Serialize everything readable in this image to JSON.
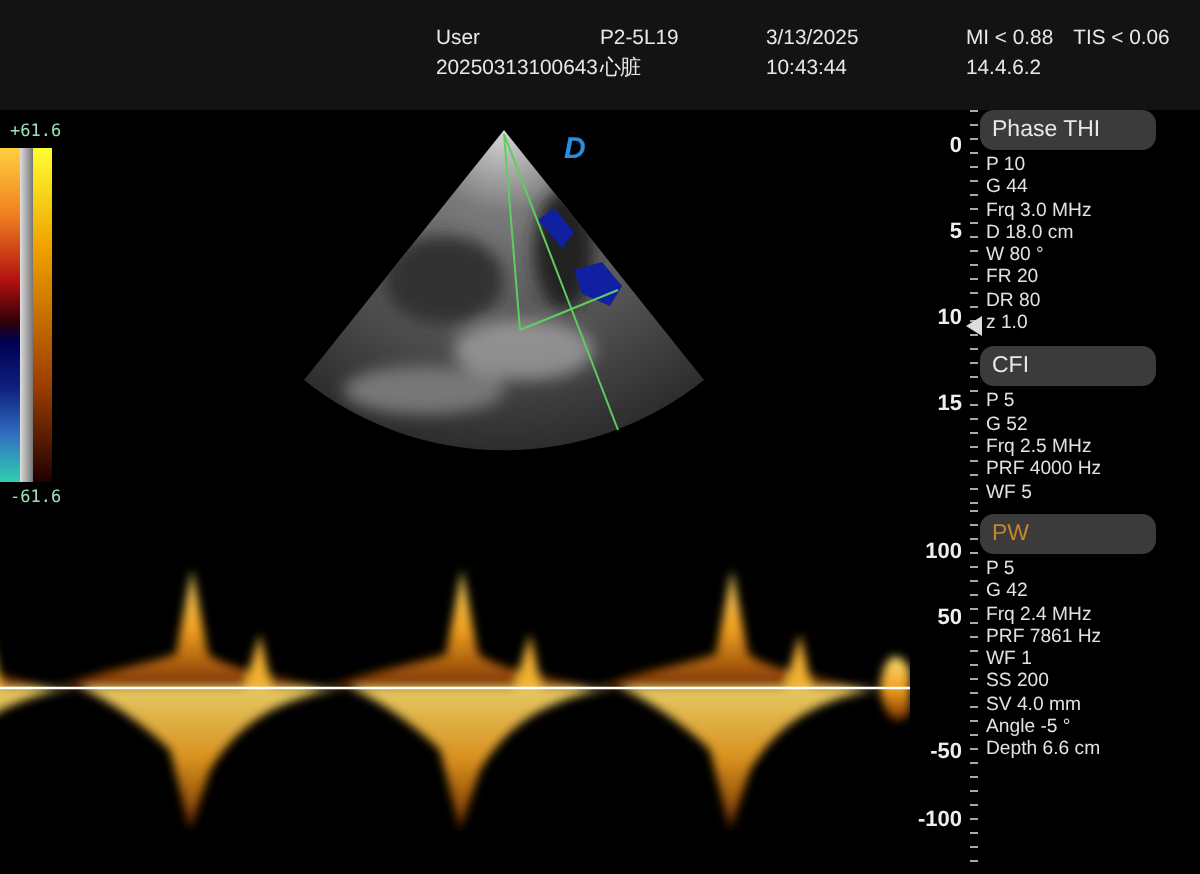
{
  "header": {
    "user": "User",
    "patient_id": "20250313100643",
    "probe": "P2-5L19",
    "preset": "心脏",
    "date": "3/13/2025",
    "time": "10:43:44",
    "mi": "MI < 0.88",
    "tis": "TIS < 0.06",
    "version": "14.4.6.2"
  },
  "color_bar": {
    "max": "+61.6",
    "min": "-61.6"
  },
  "image": {
    "orientation_mark": "D"
  },
  "depth_scale": {
    "labels": [
      "0",
      "5",
      "10",
      "15"
    ]
  },
  "velocity_scale": {
    "labels": [
      "100",
      "50",
      "-50",
      "-100"
    ]
  },
  "imaging_panels": [
    {
      "title": "Phase THI",
      "active": false,
      "params": [
        "P 10",
        "G 44",
        "Frq 3.0 MHz",
        "D 18.0 cm",
        "W 80 °",
        "FR 20",
        "DR 80",
        "z 1.0"
      ]
    },
    {
      "title": "CFI",
      "active": false,
      "params": [
        "P 5",
        "G 52",
        "Frq 2.5 MHz",
        "PRF 4000 Hz",
        "WF 5"
      ]
    }
  ],
  "doppler_panels": [
    {
      "title": "PW",
      "active": true,
      "params": [
        "P 5",
        "G 42",
        "Frq 2.4 MHz",
        "PRF 7861 Hz",
        "WF 1",
        "SS 200",
        "SV 4.0 mm",
        "Angle -5 °",
        "Depth 6.6 cm"
      ]
    }
  ]
}
